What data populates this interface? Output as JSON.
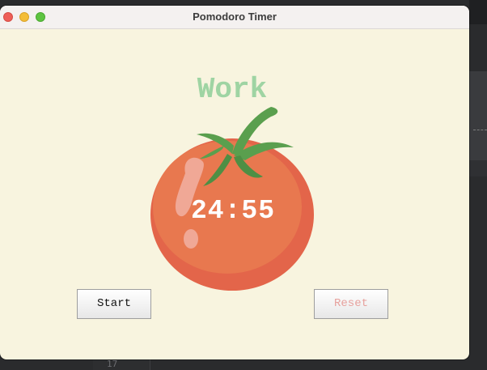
{
  "window": {
    "title": "Pomodoro Timer"
  },
  "timer": {
    "mode_label": "Work",
    "time_display": "24:55"
  },
  "buttons": {
    "start_label": "Start",
    "reset_label": "Reset"
  },
  "background_editor": {
    "line_number": "17"
  },
  "colors": {
    "window_bg": "#f8f4df",
    "mode_label": "#9fd4a3",
    "tomato": "#e8734f",
    "leaf": "#5a9f4e",
    "reset_text": "#e7a19d"
  }
}
